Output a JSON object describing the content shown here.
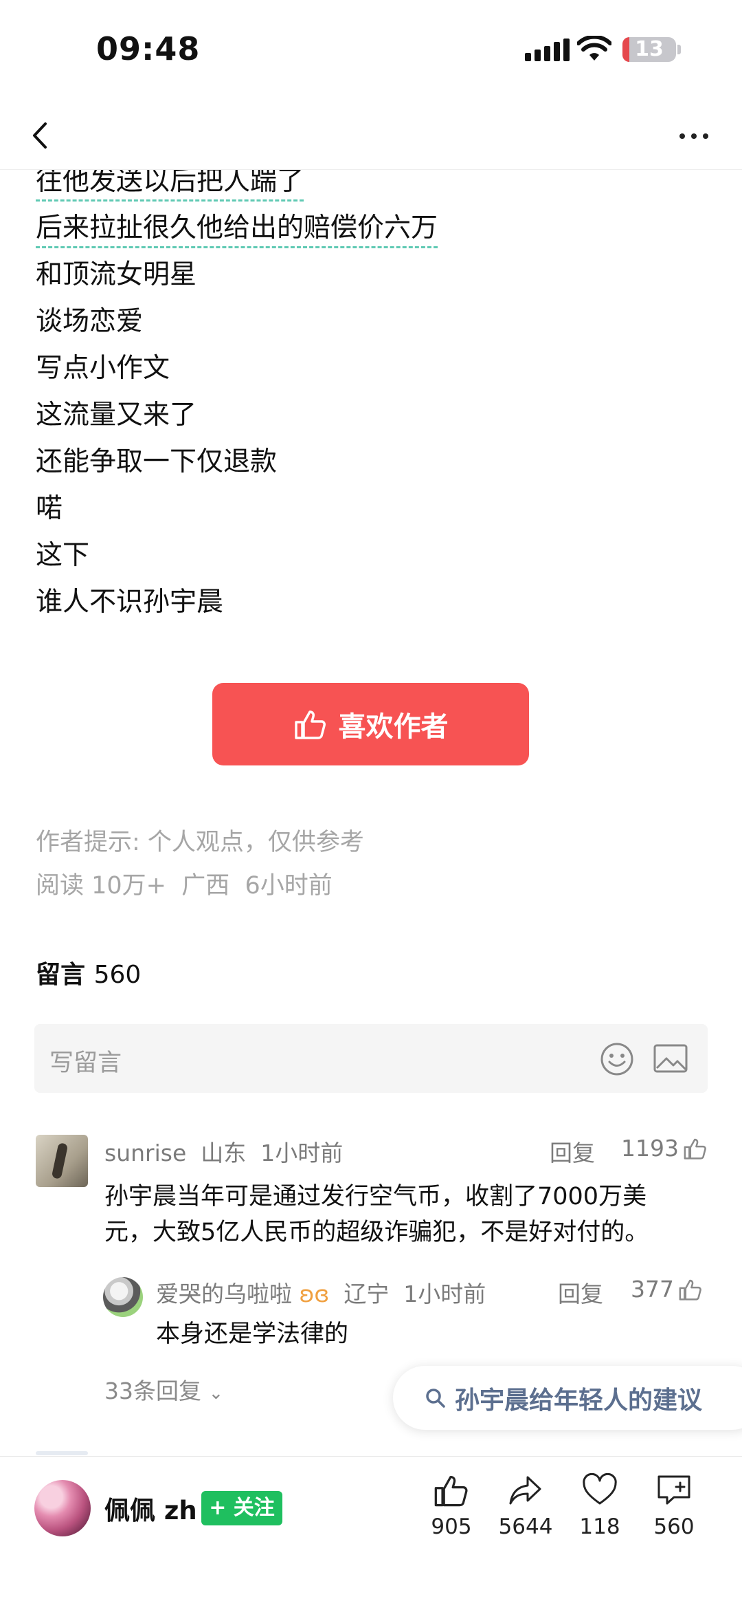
{
  "status_bar": {
    "time": "09:48",
    "battery": "13"
  },
  "article": {
    "lines": [
      "往他发送以后把人踹了",
      "后来拉扯很久他给出的赔偿价六万",
      "和顶流女明星",
      "谈场恋爱",
      "写点小作文",
      "这流量又来了",
      "还能争取一下仅退款",
      "喏",
      "这下",
      "谁人不识孙宇晨"
    ],
    "like_author_label": "喜欢作者",
    "author_tip": "作者提示: 个人观点，仅供参考",
    "meta": "阅读 10万+  广西  6小时前"
  },
  "comments": {
    "title": "留言",
    "count": "560",
    "write_placeholder": "写留言",
    "items": [
      {
        "user": "sunrise",
        "location": "山东",
        "time": "1小时前",
        "reply_label": "回复",
        "likes": "1193",
        "text_line1": "孙宇晨当年可是通过发行空气币，收割了7000万美",
        "text_line2": "元，大致5亿人民币的超级诈骗犯，不是好对付的。",
        "replies": [
          {
            "user": "爱哭的乌啦啦",
            "location": "辽宁",
            "time": "1小时前",
            "reply_label": "回复",
            "likes": "377",
            "text": "本身还是学法律的"
          }
        ],
        "more_replies": "33条回复"
      }
    ]
  },
  "search_suggestion": "孙宇晨给年轻人的建议",
  "bottom_bar": {
    "author_name": "佩佩 zh",
    "follow_label": "+ 关注",
    "actions": [
      {
        "icon": "thumbs-up-icon",
        "count": "905"
      },
      {
        "icon": "share-icon",
        "count": "5644"
      },
      {
        "icon": "heart-icon",
        "count": "118"
      },
      {
        "icon": "comment-add-icon",
        "count": "560"
      }
    ]
  },
  "colors": {
    "like_button": "#f75353",
    "follow_button": "#1fbf5f",
    "link_underline": "#5fc9b3",
    "muted_text": "#a6a6a6"
  }
}
